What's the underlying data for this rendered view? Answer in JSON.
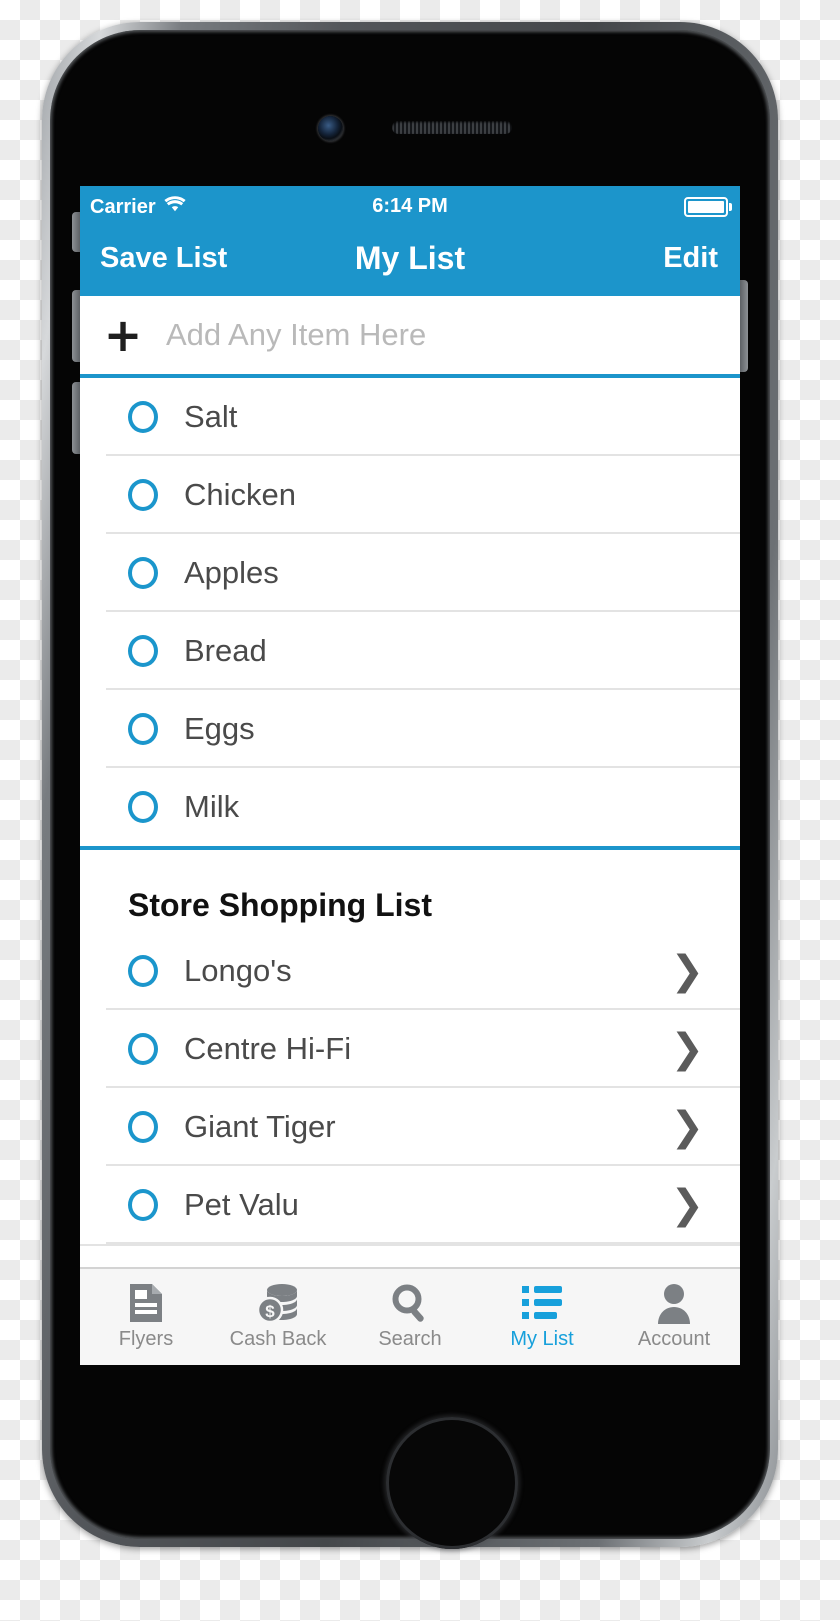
{
  "device": {
    "name": "iphone-mockup",
    "frame_color": "#53565a",
    "screen_bg": "#ffffff"
  },
  "theme": {
    "accent": "#1c95cb",
    "accent_tab_active": "#17a0db",
    "text_primary": "#4a4a4a",
    "text_heading": "#111111",
    "placeholder": "#b9b9b9",
    "separator": "#e3e3e3",
    "tabbar_bg": "#f6f6f6",
    "tabbar_icon": "#8a8a8a"
  },
  "status_bar": {
    "carrier": "Carrier",
    "wifi_icon": "wifi-icon",
    "time": "6:14 PM",
    "battery_icon": "battery-full-icon",
    "battery_level": 100
  },
  "nav_bar": {
    "left_label": "Save List",
    "title": "My List",
    "right_label": "Edit"
  },
  "add_row": {
    "plus_icon": "plus-icon",
    "placeholder": "Add Any Item Here",
    "value": ""
  },
  "my_list": {
    "items": [
      {
        "label": "Salt",
        "checked": false,
        "checkbox_icon": "circle-unchecked-icon"
      },
      {
        "label": "Chicken",
        "checked": false,
        "checkbox_icon": "circle-unchecked-icon"
      },
      {
        "label": "Apples",
        "checked": false,
        "checkbox_icon": "circle-unchecked-icon"
      },
      {
        "label": "Bread",
        "checked": false,
        "checkbox_icon": "circle-unchecked-icon"
      },
      {
        "label": "Eggs",
        "checked": false,
        "checkbox_icon": "circle-unchecked-icon"
      },
      {
        "label": "Milk",
        "checked": false,
        "checkbox_icon": "circle-unchecked-icon"
      }
    ]
  },
  "store_section": {
    "header": "Store Shopping List",
    "items": [
      {
        "label": "Longo's",
        "checked": false,
        "checkbox_icon": "circle-unchecked-icon",
        "chevron_icon": "chevron-right-icon"
      },
      {
        "label": "Centre Hi-Fi",
        "checked": false,
        "checkbox_icon": "circle-unchecked-icon",
        "chevron_icon": "chevron-right-icon"
      },
      {
        "label": "Giant Tiger",
        "checked": false,
        "checkbox_icon": "circle-unchecked-icon",
        "chevron_icon": "chevron-right-icon"
      },
      {
        "label": "Pet Valu",
        "checked": false,
        "checkbox_icon": "circle-unchecked-icon",
        "chevron_icon": "chevron-right-icon"
      }
    ]
  },
  "tab_bar": {
    "tabs": [
      {
        "label": "Flyers",
        "icon": "flyer-document-icon",
        "active": false
      },
      {
        "label": "Cash Back",
        "icon": "coins-dollar-icon",
        "active": false
      },
      {
        "label": "Search",
        "icon": "search-icon",
        "active": false
      },
      {
        "label": "My List",
        "icon": "list-icon",
        "active": true
      },
      {
        "label": "Account",
        "icon": "person-icon",
        "active": false
      }
    ]
  }
}
